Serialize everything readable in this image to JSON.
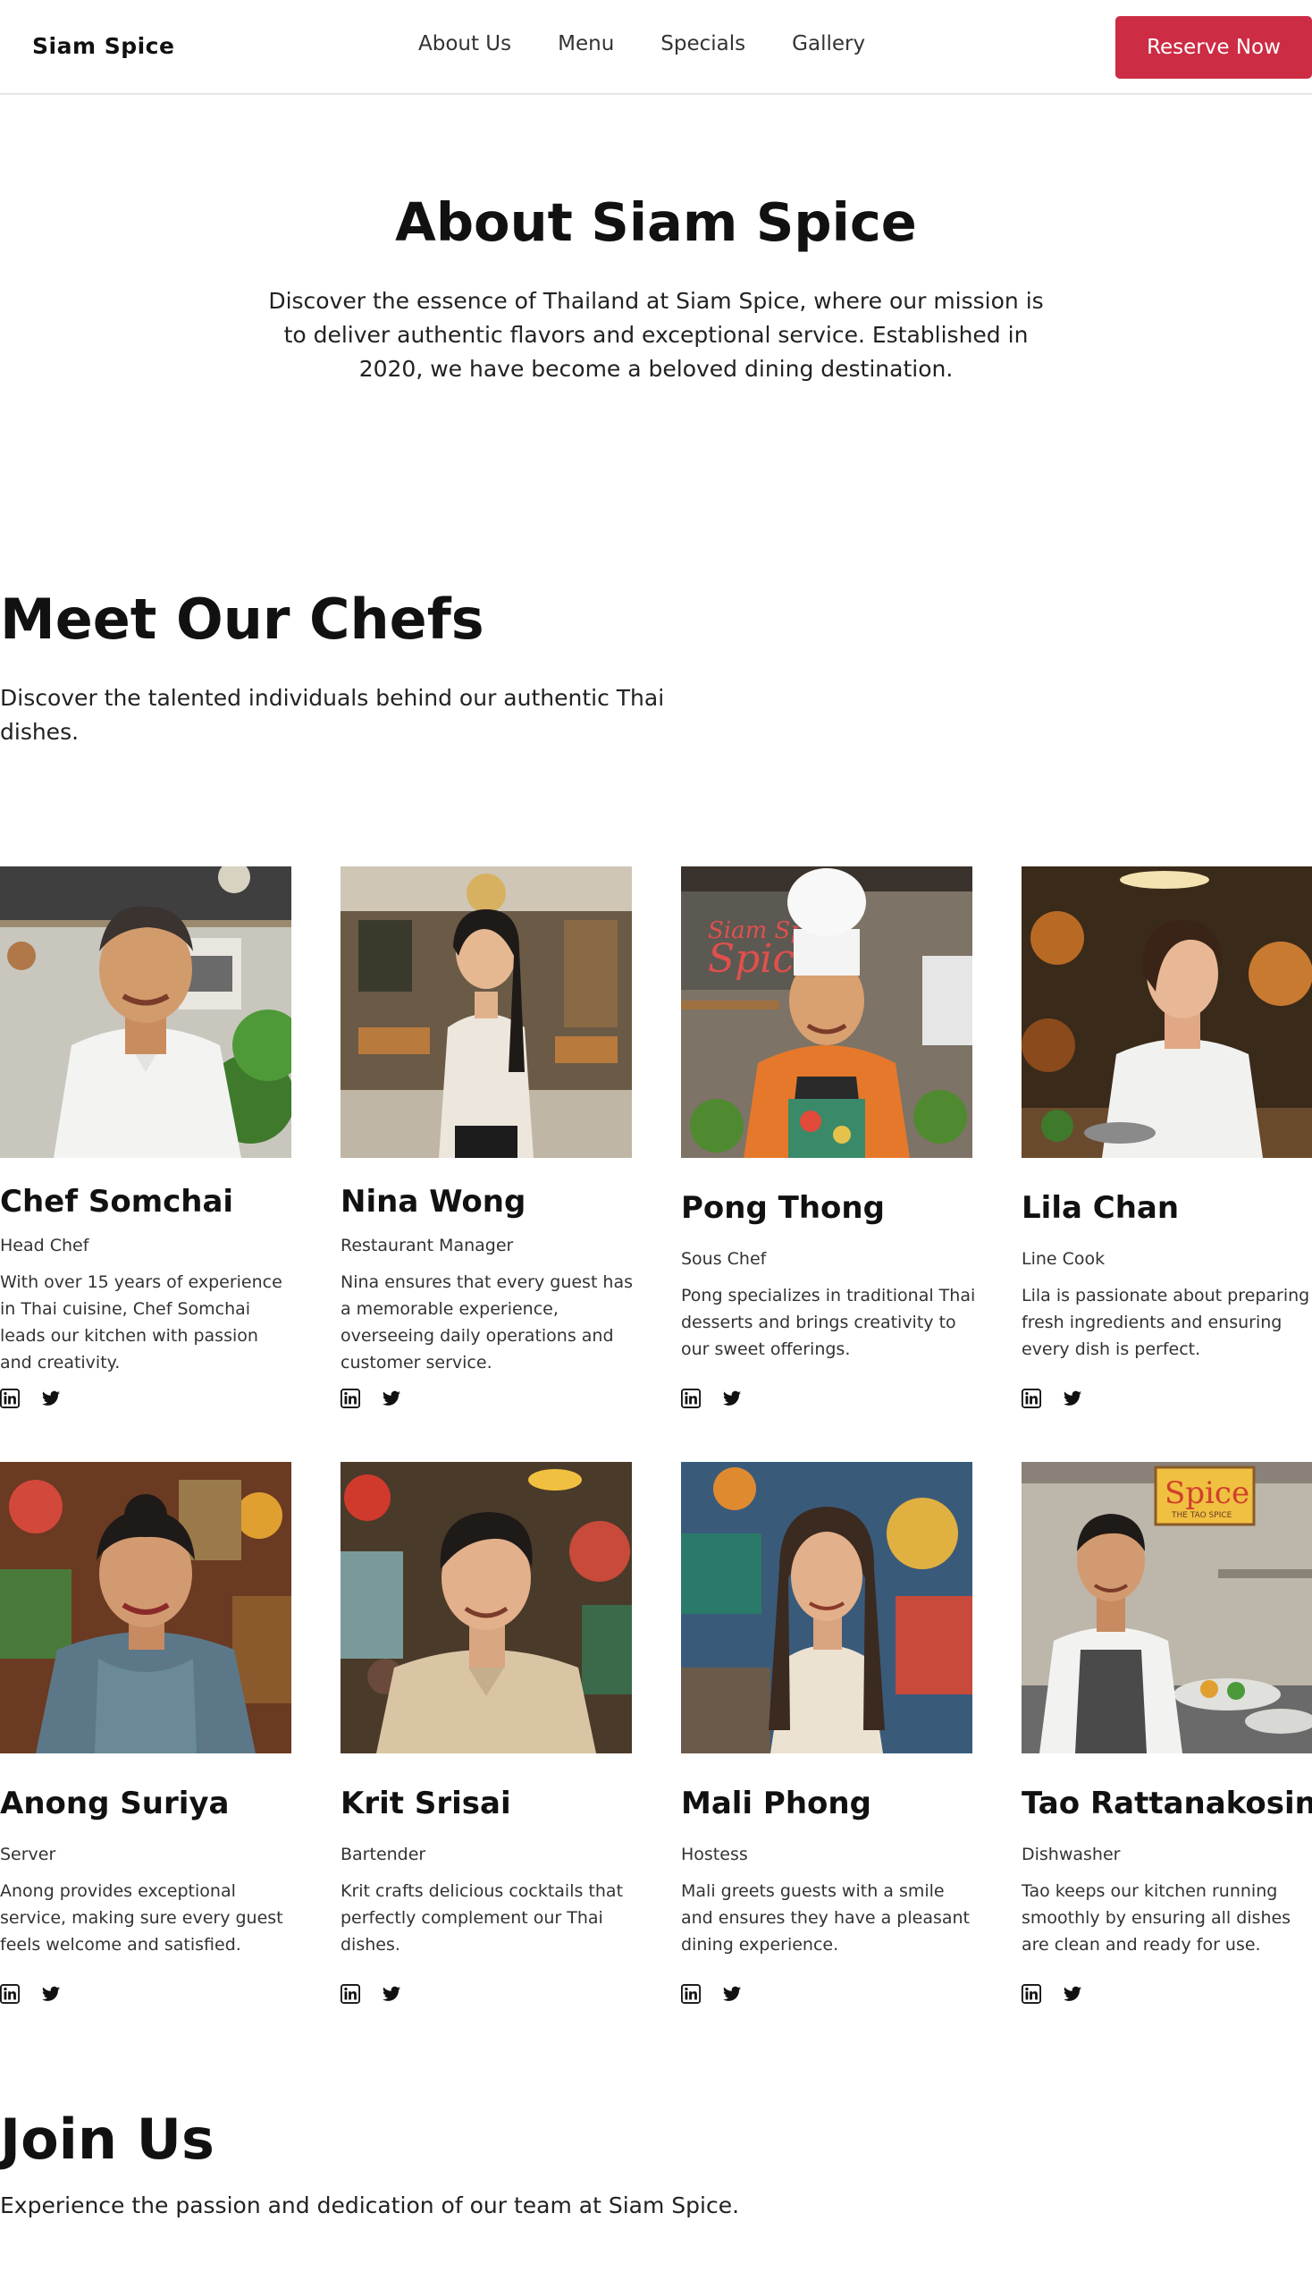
{
  "header": {
    "brand": "Siam Spice",
    "nav": [
      "About Us",
      "Menu",
      "Specials",
      "Gallery"
    ],
    "cta": "Reserve Now",
    "cta_color": "#cc2c44"
  },
  "about": {
    "title": "About Siam Spice",
    "text": "Discover the essence of Thailand at Siam Spice, where our mission is to deliver authentic flavors and exceptional service. Established in 2020, we have become a beloved dining destination."
  },
  "chefs": {
    "title": "Meet Our Chefs",
    "subtitle": "Discover the talented individuals behind our authentic Thai dishes.",
    "members": [
      {
        "name": "Chef Somchai",
        "role": "Head Chef",
        "bio": "With over 15 years of experience in Thai cuisine, Chef Somchai leads our kitchen with passion and creativity.",
        "photo": "chef-white-coat-kitchen"
      },
      {
        "name": "Nina Wong",
        "role": "Restaurant Manager",
        "bio": "Nina ensures that every guest has a memorable experience, overseeing daily operations and customer service.",
        "photo": "manager-dining-room"
      },
      {
        "name": "Pong Thong",
        "role": "Sous Chef",
        "bio": "Pong specializes in traditional Thai desserts and brings creativity to our sweet offerings.",
        "photo": "chef-toque-orange"
      },
      {
        "name": "Lila Chan",
        "role": "Line Cook",
        "bio": "Lila is passionate about preparing fresh ingredients and ensuring every dish is perfect.",
        "photo": "cook-warm-kitchen"
      },
      {
        "name": "Anong Suriya",
        "role": "Server",
        "bio": "Anong provides exceptional service, making sure every guest feels welcome and satisfied.",
        "photo": "server-traditional-dress"
      },
      {
        "name": "Krit Srisai",
        "role": "Bartender",
        "bio": "Krit crafts delicious cocktails that perfectly complement our Thai dishes.",
        "photo": "bartender-colorful-bar"
      },
      {
        "name": "Mali Phong",
        "role": "Hostess",
        "bio": "Mali greets guests with a smile and ensures they have a pleasant dining experience.",
        "photo": "hostess-colorful-restaurant"
      },
      {
        "name": "Tao Rattanakosin",
        "role": "Dishwasher",
        "bio": "Tao keeps our kitchen running smoothly by ensuring all dishes are clean and ready for use.",
        "photo": "cook-plating-kitchen"
      }
    ],
    "social_icons": [
      "linkedin-icon",
      "twitter-icon"
    ]
  },
  "photo_signs": {
    "pong_sign_line1": "Siam Spice",
    "pong_sign_line2": "Spice",
    "tao_sign_line1": "Spice",
    "tao_sign_line2": "THE TAO SPICE"
  },
  "join": {
    "title": "Join Us",
    "text": "Experience the passion and dedication of our team at Siam Spice."
  }
}
